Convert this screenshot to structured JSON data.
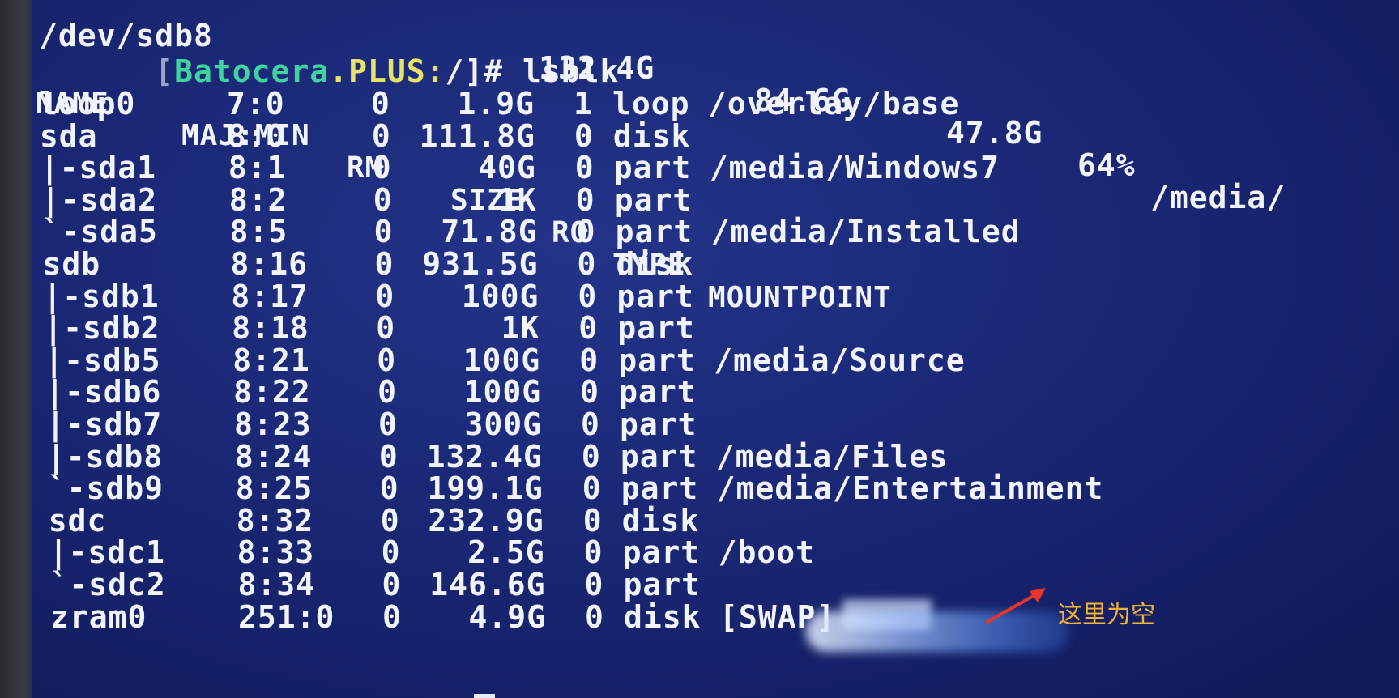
{
  "prev_output": {
    "device": "/dev/sdb8",
    "size": "132.4G",
    "used": "84.6G",
    "avail": "47.8G",
    "use_pct": "64%",
    "mount": "/media/"
  },
  "prompt": {
    "open": "[",
    "host": "Batocera",
    "dot": ".",
    "plus": "PLUS",
    "colon": ":",
    "rest": "/]# lsblk"
  },
  "lsblk": {
    "headers": [
      "NAME",
      "MAJ:MIN",
      "RM",
      "SIZE",
      "RO",
      "TYPE",
      "MOUNTPOINT"
    ],
    "rows": [
      {
        "name": "loop0",
        "majmin": "7:0",
        "rm": "0",
        "size": "1.9G",
        "ro": "1",
        "type": "loop",
        "mount": "/overlay/base"
      },
      {
        "name": "sda",
        "majmin": "8:0",
        "rm": "0",
        "size": "111.8G",
        "ro": "0",
        "type": "disk",
        "mount": ""
      },
      {
        "name": "|-sda1",
        "majmin": "8:1",
        "rm": "0",
        "size": "40G",
        "ro": "0",
        "type": "part",
        "mount": "/media/Windows7"
      },
      {
        "name": "|-sda2",
        "majmin": "8:2",
        "rm": "0",
        "size": "1K",
        "ro": "0",
        "type": "part",
        "mount": ""
      },
      {
        "name": "`-sda5",
        "majmin": "8:5",
        "rm": "0",
        "size": "71.8G",
        "ro": "0",
        "type": "part",
        "mount": "/media/Installed"
      },
      {
        "name": "sdb",
        "majmin": "8:16",
        "rm": "0",
        "size": "931.5G",
        "ro": "0",
        "type": "disk",
        "mount": ""
      },
      {
        "name": "|-sdb1",
        "majmin": "8:17",
        "rm": "0",
        "size": "100G",
        "ro": "0",
        "type": "part",
        "mount": ""
      },
      {
        "name": "|-sdb2",
        "majmin": "8:18",
        "rm": "0",
        "size": "1K",
        "ro": "0",
        "type": "part",
        "mount": ""
      },
      {
        "name": "|-sdb5",
        "majmin": "8:21",
        "rm": "0",
        "size": "100G",
        "ro": "0",
        "type": "part",
        "mount": "/media/Source"
      },
      {
        "name": "|-sdb6",
        "majmin": "8:22",
        "rm": "0",
        "size": "100G",
        "ro": "0",
        "type": "part",
        "mount": ""
      },
      {
        "name": "|-sdb7",
        "majmin": "8:23",
        "rm": "0",
        "size": "300G",
        "ro": "0",
        "type": "part",
        "mount": ""
      },
      {
        "name": "|-sdb8",
        "majmin": "8:24",
        "rm": "0",
        "size": "132.4G",
        "ro": "0",
        "type": "part",
        "mount": "/media/Files"
      },
      {
        "name": "`-sdb9",
        "majmin": "8:25",
        "rm": "0",
        "size": "199.1G",
        "ro": "0",
        "type": "part",
        "mount": "/media/Entertainment"
      },
      {
        "name": "sdc",
        "majmin": "8:32",
        "rm": "0",
        "size": "232.9G",
        "ro": "0",
        "type": "disk",
        "mount": ""
      },
      {
        "name": "|-sdc1",
        "majmin": "8:33",
        "rm": "0",
        "size": "2.5G",
        "ro": "0",
        "type": "part",
        "mount": "/boot"
      },
      {
        "name": "`-sdc2",
        "majmin": "8:34",
        "rm": "0",
        "size": "146.6G",
        "ro": "0",
        "type": "part",
        "mount": ""
      },
      {
        "name": "zram0",
        "majmin": "251:0",
        "rm": "0",
        "size": "4.9G",
        "ro": "0",
        "type": "disk",
        "mount": "[SWAP]"
      }
    ]
  },
  "annotation": {
    "text": "这里为空",
    "color": "#f2b233"
  },
  "icons": {
    "arrow": "red-arrow-icon"
  }
}
